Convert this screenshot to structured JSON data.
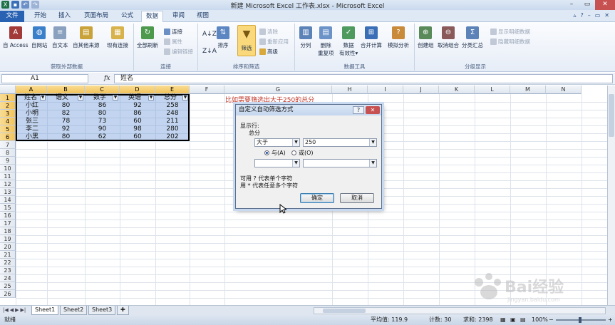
{
  "window": {
    "title": "新建 Microsoft Excel 工作表.xlsx - Microsoft Excel",
    "controls": [
      "–",
      "▭",
      "✕"
    ]
  },
  "ribbon_tabs": [
    "文件",
    "开始",
    "插入",
    "页面布局",
    "公式",
    "数据",
    "审阅",
    "视图"
  ],
  "ribbon": {
    "external": {
      "label": "获取外部数据",
      "buttons": [
        "自 Access",
        "自网站",
        "自文本",
        "自其他来源"
      ],
      "existing": "现有连接"
    },
    "connections": {
      "label": "连接",
      "refresh": "全部刷新",
      "items": [
        "连接",
        "属性",
        "编辑链接"
      ]
    },
    "sortfilter": {
      "label": "排序和筛选",
      "sort": "排序",
      "filter": "筛选",
      "items": [
        "清除",
        "重新应用",
        "高级"
      ]
    },
    "datatools": {
      "label": "数据工具",
      "buttons": [
        "分列",
        "删除\n重复项",
        "数据\n有效性▾",
        "合并计算",
        "模拟分析"
      ]
    },
    "outline": {
      "label": "分级显示",
      "buttons": [
        "创建组",
        "取消组合",
        "分类汇总"
      ],
      "items": [
        "显示明细数据",
        "隐藏明细数据"
      ]
    }
  },
  "formula_bar": {
    "name_box": "A1",
    "fx": "fx",
    "content": "姓名"
  },
  "columns": [
    "A",
    "B",
    "C",
    "D",
    "E",
    "F",
    "G",
    "H",
    "I",
    "J",
    "K",
    "L",
    "M",
    "N"
  ],
  "rows": [
    "1",
    "2",
    "3",
    "4",
    "5",
    "6",
    "7",
    "8",
    "9",
    "10",
    "11",
    "12",
    "13",
    "14",
    "15",
    "16",
    "17",
    "18",
    "19",
    "20",
    "21",
    "22",
    "23",
    "24",
    "25",
    "26"
  ],
  "table": {
    "headers": [
      "姓名",
      "语文",
      "数学",
      "英语",
      "总分"
    ],
    "rows": [
      [
        "小红",
        "80",
        "86",
        "92",
        "258"
      ],
      [
        "小明",
        "82",
        "80",
        "86",
        "248"
      ],
      [
        "张三",
        "78",
        "73",
        "60",
        "211"
      ],
      [
        "李二",
        "92",
        "90",
        "98",
        "280"
      ],
      [
        "小黑",
        "80",
        "62",
        "60",
        "202"
      ]
    ]
  },
  "note": "比如需要筛选出大于250的总分",
  "dialog": {
    "title": "自定义自动筛选方式",
    "help": "?",
    "close": "✕",
    "show_rows": "显示行:",
    "field": "总分",
    "op1": "大于",
    "val1": "250",
    "op2": "",
    "val2": "",
    "and_label": "与(A)",
    "or_label": "或(O)",
    "hint1": "可用 ? 代表单个字符",
    "hint2": "用 * 代表任意多个字符",
    "ok": "确定",
    "cancel": "取消"
  },
  "sheets": [
    "Sheet1",
    "Sheet2",
    "Sheet3"
  ],
  "status": {
    "ready": "就绪",
    "avg": "平均值: 119.9",
    "count": "计数: 30",
    "sum": "求和: 2398",
    "zoom": "100%"
  }
}
